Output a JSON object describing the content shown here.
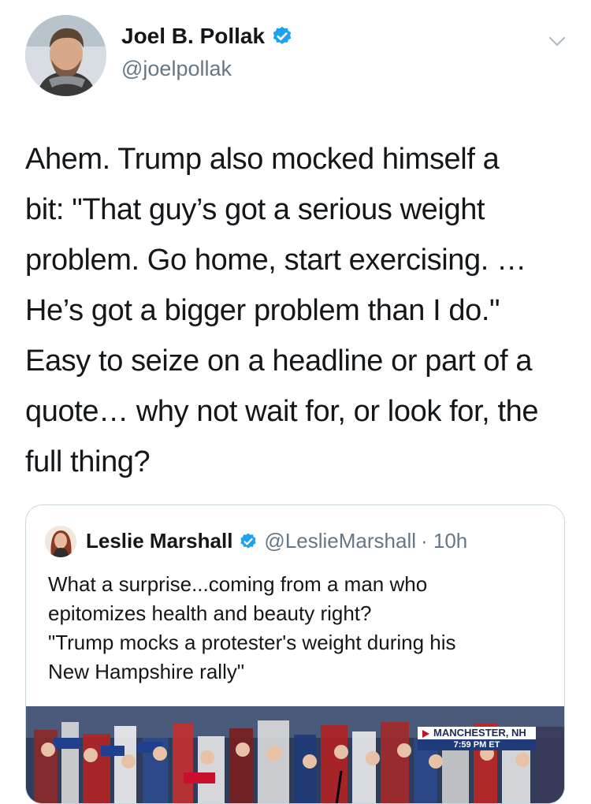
{
  "tweet": {
    "author_name": "Joel B. Pollak",
    "author_handle": "@joelpollak",
    "text": "Ahem. Trump also mocked himself a\nbit: \"That guy’s got a serious weight\nproblem. Go home, start exercising. …\nHe’s got a bigger problem than I do.\"\nEasy to seize on a headline or part of a\nquote… why not wait for, or look for, the\nfull thing?"
  },
  "quoted_tweet": {
    "author_name": "Leslie Marshall",
    "author_handle": "@LeslieMarshall",
    "timestamp": "· 10h",
    "text": "What a surprise...coming from a man who\nepitomizes health and beauty right?\n\"Trump mocks a protester's weight during his\nNew Hampshire rally\"",
    "media": {
      "chyron_location": "MANCHESTER, NH",
      "chyron_time": "7:59 PM ET"
    }
  },
  "colors": {
    "verified_blue": "#1da1f2",
    "secondary_text": "#657786",
    "border": "#ccd6dd"
  },
  "icons": {
    "verified": "verified-badge-icon",
    "caret": "chevron-down-icon"
  }
}
